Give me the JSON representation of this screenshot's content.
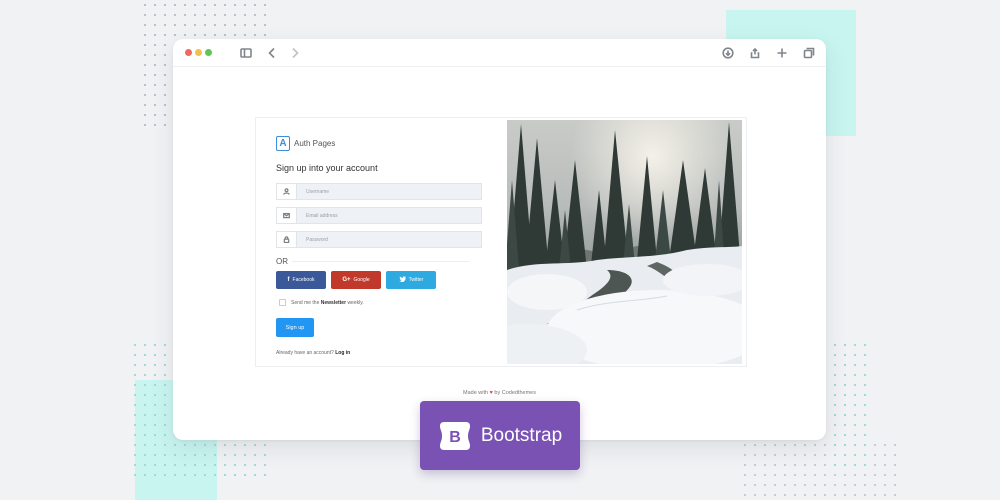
{
  "auth": {
    "brand_letter": "A",
    "brand_name": "Auth Pages",
    "heading": "Sign up into your account",
    "fields": {
      "username_placeholder": "Username",
      "email_placeholder": "Email address",
      "password_placeholder": "Password"
    },
    "or_text": "OR",
    "social": {
      "facebook_label": "Facebook",
      "facebook_glyph": "f",
      "google_label": "Google",
      "google_glyph": "G+",
      "twitter_label": "Twitter",
      "twitter_glyph": "t"
    },
    "newsletter": {
      "prefix": "Send me the",
      "bold": "Newsletter",
      "suffix": "weekly."
    },
    "signup_label": "Sign up",
    "login_prompt": "Already have an account?",
    "login_link": "Log in"
  },
  "footer": {
    "made_with": "Made with",
    "heart": "♥",
    "by": "by Codedthemes"
  },
  "badge": {
    "logo_letter": "B",
    "name": "Bootstrap"
  },
  "colors": {
    "facebook": "#3b5998",
    "google": "#c0392b",
    "twitter": "#2eaae1",
    "primary": "#2196f3",
    "bootstrap": "#7952b3"
  }
}
